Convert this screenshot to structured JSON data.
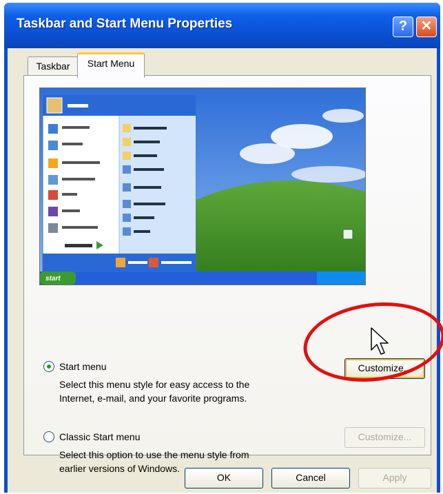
{
  "window": {
    "title": "Taskbar and Start Menu Properties"
  },
  "tabs": [
    {
      "label": "Taskbar"
    },
    {
      "label": "Start Menu"
    }
  ],
  "options": {
    "start_menu": {
      "label": "Start menu",
      "description_line1": "Select this menu style for easy access to the",
      "description_line2": "Internet, e-mail, and your favorite programs.",
      "customize_label": "Customize...",
      "selected": true
    },
    "classic": {
      "label": "Classic Start menu",
      "description_line1": "Select this option to use the menu style from",
      "description_line2": "earlier versions of Windows.",
      "customize_label": "Customize...",
      "selected": false
    }
  },
  "buttons": {
    "ok": "OK",
    "cancel": "Cancel",
    "apply": "Apply"
  },
  "preview": {
    "start_label": "start"
  },
  "colors": {
    "title_blue": "#0a4fd1",
    "highlight_red": "#e01010",
    "selected_radio": "#21a121"
  }
}
